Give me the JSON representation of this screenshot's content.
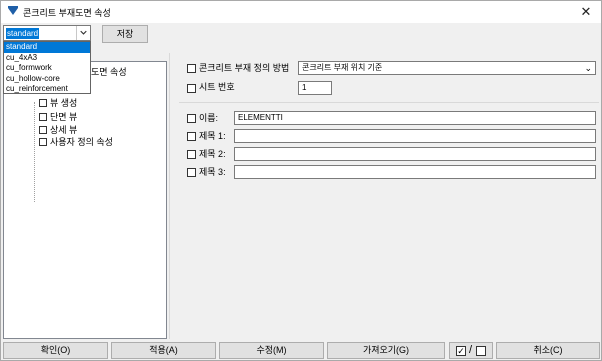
{
  "window": {
    "title": "콘크리트 부재도면 속성",
    "close_icon": "close-icon"
  },
  "toolbar": {
    "preset_value": "standard",
    "save_label": "저장"
  },
  "preset_dropdown": {
    "options": [
      "standard",
      "cu_4xA3",
      "cu_formwork",
      "cu_hollow-core",
      "cu_reinforcement"
    ],
    "selected": "standard"
  },
  "tree": {
    "root_label_partial": "도면 속성",
    "items": [
      "뷰 생성",
      "단면 뷰",
      "상세 뷰",
      "사용자 정의 속성"
    ]
  },
  "form": {
    "definition_method_label": "콘크리트 부재 정의 방법",
    "definition_method_value": "콘크리트 부재 위치 기준",
    "sheet_number_label": "시트 번호",
    "sheet_number_value": "1",
    "name_label": "이름:",
    "name_value": "ELEMENTTI",
    "title1_label": "제목 1:",
    "title1_value": "",
    "title2_label": "제목 2:",
    "title2_value": "",
    "title3_label": "제목 3:",
    "title3_value": ""
  },
  "buttons": {
    "ok": "확인(O)",
    "apply": "적용(A)",
    "modify": "수정(M)",
    "get": "가져오기(G)",
    "cancel": "취소(C)"
  },
  "colors": {
    "selection": "#0078d7",
    "button_face": "#e1e1e1",
    "window_bg": "#f0f0f0"
  }
}
